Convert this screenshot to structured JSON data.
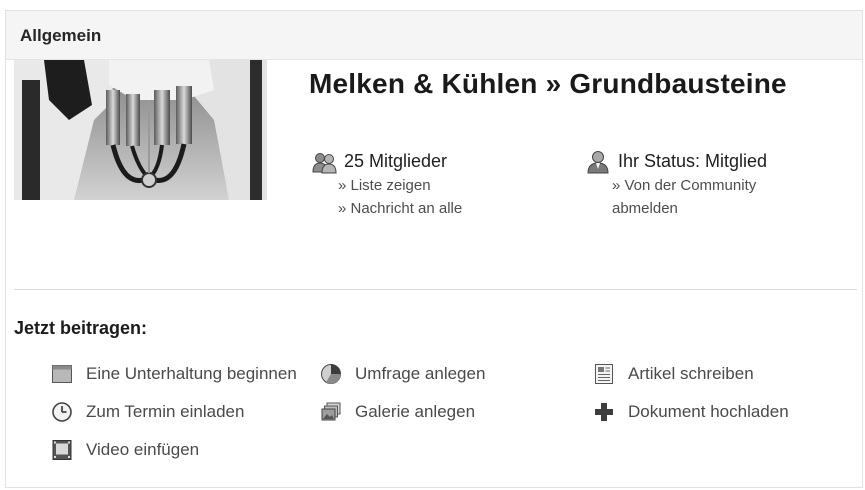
{
  "panel": {
    "title": "Allgemein"
  },
  "community": {
    "title": "Melken & Kühlen » Grundbausteine",
    "image_icon": "milking-machine-photo"
  },
  "members": {
    "icon": "members-icon",
    "count_label": "25 Mitglieder",
    "links": [
      "» Liste zeigen",
      "» Nachricht an alle"
    ]
  },
  "status": {
    "icon": "user-status-icon",
    "label": "Ihr Status: Mitglied",
    "link_line1": "» Von der Community",
    "link_line2": "abmelden"
  },
  "contribute": {
    "heading": "Jetzt beitragen:",
    "actions": [
      {
        "icon": "discussion-icon",
        "label": "Eine Unterhaltung beginnen"
      },
      {
        "icon": "poll-icon",
        "label": "Umfrage anlegen"
      },
      {
        "icon": "article-icon",
        "label": "Artikel schreiben"
      },
      {
        "icon": "clock-icon",
        "label": "Zum Termin einladen"
      },
      {
        "icon": "gallery-icon",
        "label": "Galerie anlegen"
      },
      {
        "icon": "plus-icon",
        "label": "Dokument hochladen"
      },
      {
        "icon": "video-icon",
        "label": "Video einfügen"
      }
    ]
  }
}
